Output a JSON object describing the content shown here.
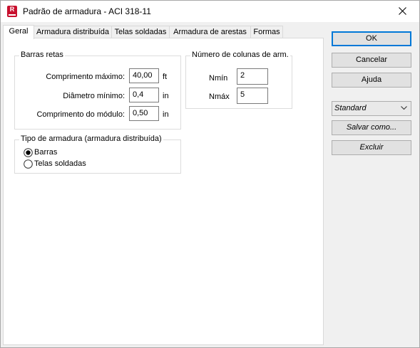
{
  "window": {
    "title": "Padrão de armadura - ACI 318-11"
  },
  "tabs": [
    {
      "label": "Geral"
    },
    {
      "label": "Armadura distribuída"
    },
    {
      "label": "Telas soldadas"
    },
    {
      "label": "Armadura de arestas"
    },
    {
      "label": "Formas"
    }
  ],
  "barras_retas": {
    "legend": "Barras retas",
    "comprimento_maximo": {
      "label": "Comprimento máximo:",
      "value": "40,00",
      "unit": "ft"
    },
    "diametro_minimo": {
      "label": "Diâmetro mínimo:",
      "value": "0,4",
      "unit": "in"
    },
    "comprimento_modulo": {
      "label": "Comprimento do módulo:",
      "value": "0,50",
      "unit": "in"
    }
  },
  "colunas": {
    "legend": "Número de colunas de arm.",
    "nmin": {
      "label": "Nmín",
      "value": "2"
    },
    "nmax": {
      "label": "Nmáx",
      "value": "5"
    }
  },
  "tipo_armadura": {
    "legend": "Tipo de armadura (armadura distribuída)",
    "options": [
      {
        "label": "Barras",
        "selected": true
      },
      {
        "label": "Telas soldadas",
        "selected": false
      }
    ]
  },
  "buttons": {
    "ok": "OK",
    "cancelar": "Cancelar",
    "ajuda": "Ajuda",
    "salvar": "Salvar como...",
    "excluir": "Excluir"
  },
  "standard_select": {
    "value": "Standard"
  },
  "colors": {
    "accent": "#0078d7",
    "brand": "#c8102e"
  }
}
